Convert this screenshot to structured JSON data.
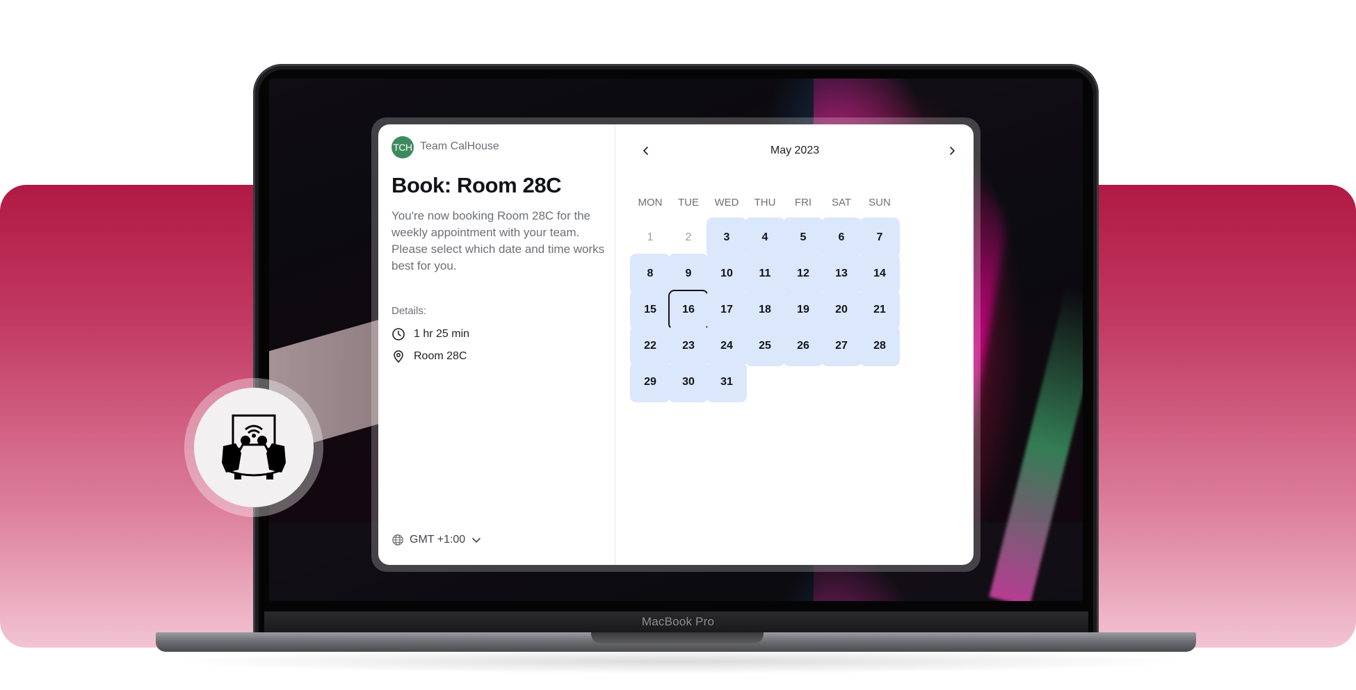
{
  "laptop": {
    "brand": "MacBook Pro"
  },
  "booking": {
    "team": {
      "initials": "TCH",
      "name": "Team CalHouse"
    },
    "title": "Book: Room 28C",
    "description": "You're now booking Room 28C for the weekly appointment with your team. Please select which date and time works best for you.",
    "details_label": "Details:",
    "duration": "1 hr 25 min",
    "location": "Room 28C",
    "timezone": "GMT +1:00"
  },
  "calendar": {
    "month_label": "May 2023",
    "weekdays": [
      "MON",
      "TUE",
      "WED",
      "THU",
      "FRI",
      "SAT",
      "SUN"
    ],
    "days": [
      {
        "day": "1",
        "state": "disabled"
      },
      {
        "day": "2",
        "state": "disabled"
      },
      {
        "day": "3",
        "state": "available"
      },
      {
        "day": "4",
        "state": "available"
      },
      {
        "day": "5",
        "state": "available"
      },
      {
        "day": "6",
        "state": "available"
      },
      {
        "day": "7",
        "state": "available"
      },
      {
        "day": "8",
        "state": "available"
      },
      {
        "day": "9",
        "state": "available"
      },
      {
        "day": "10",
        "state": "available"
      },
      {
        "day": "11",
        "state": "available"
      },
      {
        "day": "12",
        "state": "available"
      },
      {
        "day": "13",
        "state": "available"
      },
      {
        "day": "14",
        "state": "available"
      },
      {
        "day": "15",
        "state": "available"
      },
      {
        "day": "16",
        "state": "selected"
      },
      {
        "day": "17",
        "state": "available"
      },
      {
        "day": "18",
        "state": "available"
      },
      {
        "day": "19",
        "state": "available"
      },
      {
        "day": "20",
        "state": "available"
      },
      {
        "day": "21",
        "state": "available"
      },
      {
        "day": "22",
        "state": "available"
      },
      {
        "day": "23",
        "state": "available"
      },
      {
        "day": "24",
        "state": "available"
      },
      {
        "day": "25",
        "state": "available"
      },
      {
        "day": "26",
        "state": "available"
      },
      {
        "day": "27",
        "state": "available"
      },
      {
        "day": "28",
        "state": "available"
      },
      {
        "day": "29",
        "state": "available"
      },
      {
        "day": "30",
        "state": "available"
      },
      {
        "day": "31",
        "state": "available"
      }
    ]
  },
  "icons": {
    "prev": "chevron-left-icon",
    "next": "chevron-right-icon",
    "duration": "clock-icon",
    "location": "map-pin-icon",
    "timezone": "globe-icon",
    "timezone_toggle": "chevron-down-icon",
    "room": "conference-room-icon"
  },
  "colors": {
    "band_top": "#b01a44",
    "band_bottom": "#f2c4d3",
    "day_available": "#dbe7fb",
    "avatar": "#3d8a5d"
  }
}
